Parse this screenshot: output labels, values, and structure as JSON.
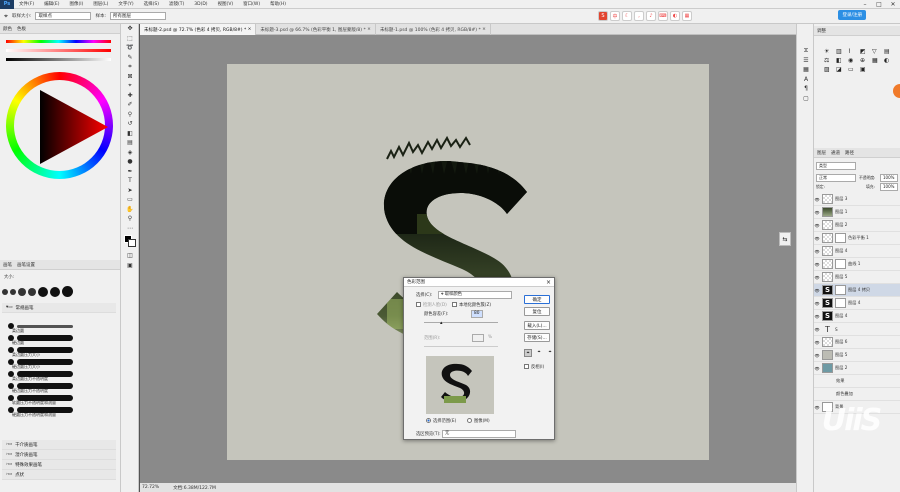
{
  "menubar": {
    "logo": "Ps",
    "items": [
      "文件(F)",
      "编辑(E)",
      "图像(I)",
      "图层(L)",
      "文字(Y)",
      "选择(S)",
      "滤镜(T)",
      "3D(D)",
      "视图(V)",
      "窗口(W)",
      "帮助(H)"
    ],
    "login": "登录/注册"
  },
  "options": {
    "sample_size_label": "取样大小:",
    "sample_size_value": "取样点",
    "sample_label": "样本:",
    "sample_value": "所有图层"
  },
  "left": {
    "color_tabs": [
      "颜色",
      "色板"
    ],
    "brush_tabs": [
      "画笔",
      "画笔设置"
    ],
    "size_label": "大小:",
    "group_name": "常规画笔",
    "brushes": [
      "柔边圆",
      "硬边圆",
      "柔边圆压力大小",
      "硬边圆压力大小",
      "柔边圆压力不透明度",
      "硬边圆压力不透明度",
      "软圆压力不透明度和流量",
      "硬圆压力不透明度和流量"
    ],
    "folders": [
      "干介质画笔",
      "湿介质画笔",
      "特殊效果画笔",
      "点状"
    ]
  },
  "tabs": [
    "未标题-2.psd @ 72.7% (色彩 4 拷贝, RGB/8#) *",
    "未标题-3.psd @ 66.7% (色彩平衡 1, 图层蒙版/8) *",
    "未标题-1.psd @ 100% (色彩 4 拷贝, RGB/8#) *"
  ],
  "status": {
    "zoom": "72.72%",
    "doc": "文档:6.38M/122.7M"
  },
  "right": {
    "adjust_tab": "调整",
    "layer_tabs": [
      "图层",
      "通道",
      "路径"
    ],
    "filter_label": "类型",
    "blend": "正常",
    "opacity_label": "不透明度:",
    "opacity": "100%",
    "lock_label": "锁定:",
    "fill_label": "填充:",
    "fill": "100%",
    "layers": [
      {
        "name": "图层 3",
        "thumb": "chk"
      },
      {
        "name": "图层 1",
        "thumb": "forest"
      },
      {
        "name": "图层 2",
        "thumb": "chk"
      },
      {
        "name": "色彩平衡 1",
        "thumb": "chk",
        "mask": true
      },
      {
        "name": "图层 4",
        "thumb": "chk"
      },
      {
        "name": "曲线 1",
        "thumb": "chk",
        "mask": true
      },
      {
        "name": "图层 5",
        "thumb": "chk"
      },
      {
        "name": "图层 4 拷贝",
        "thumb": "black",
        "mask": true,
        "selected": true
      },
      {
        "name": "图层 4",
        "thumb": "black",
        "mask": true
      },
      {
        "name": "图层 4",
        "thumb": "black"
      },
      {
        "name": "S",
        "thumb": "text"
      },
      {
        "name": "图层 6",
        "thumb": "chk"
      },
      {
        "name": "图层 5",
        "thumb": "gray"
      },
      {
        "name": "图层 2",
        "thumb": "teal"
      },
      {
        "name": "效果",
        "thumb": "none"
      },
      {
        "name": "颜色叠加",
        "thumb": "none"
      },
      {
        "name": "背景",
        "thumb": "white"
      }
    ]
  },
  "dialog": {
    "title": "色彩范围",
    "select_label": "选择(C):",
    "select_value": "取样颜色",
    "detect_faces": "检测人脸(D)",
    "localized": "本地化颜色簇(Z)",
    "fuzziness_label": "颜色容差(F):",
    "fuzziness": "80",
    "range_label": "范围(R):",
    "range_unit": "%",
    "ok": "确定",
    "reset": "复位",
    "load": "载入(L)...",
    "save": "存储(S)...",
    "invert": "反相(I)",
    "sel_radio": "选择范围(E)",
    "img_radio": "图像(M)",
    "preview_label": "选区预览(T):",
    "preview_value": "无"
  },
  "watermark": "UiiS"
}
